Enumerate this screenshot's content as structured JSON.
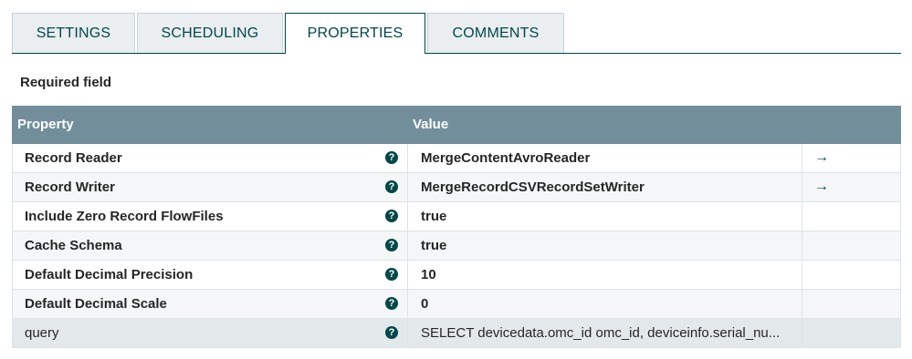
{
  "tabs": [
    {
      "label": "SETTINGS"
    },
    {
      "label": "SCHEDULING"
    },
    {
      "label": "PROPERTIES"
    },
    {
      "label": "COMMENTS"
    }
  ],
  "required_label": "Required field",
  "table": {
    "headers": {
      "property": "Property",
      "value": "Value"
    },
    "rows": [
      {
        "property": "Record Reader",
        "value": "MergeContentAvroReader",
        "help": "?",
        "action": "→"
      },
      {
        "property": "Record Writer",
        "value": "MergeRecordCSVRecordSetWriter",
        "help": "?",
        "action": "→"
      },
      {
        "property": "Include Zero Record FlowFiles",
        "value": "true",
        "help": "?"
      },
      {
        "property": "Cache Schema",
        "value": "true",
        "help": "?"
      },
      {
        "property": "Default Decimal Precision",
        "value": "10",
        "help": "?"
      },
      {
        "property": "Default Decimal Scale",
        "value": "0",
        "help": "?"
      },
      {
        "property": "query",
        "value": "SELECT devicedata.omc_id omc_id, deviceinfo.serial_nu...",
        "help": "?"
      }
    ]
  },
  "colors": {
    "accent": "#004849",
    "header_bg": "#728e9b"
  }
}
